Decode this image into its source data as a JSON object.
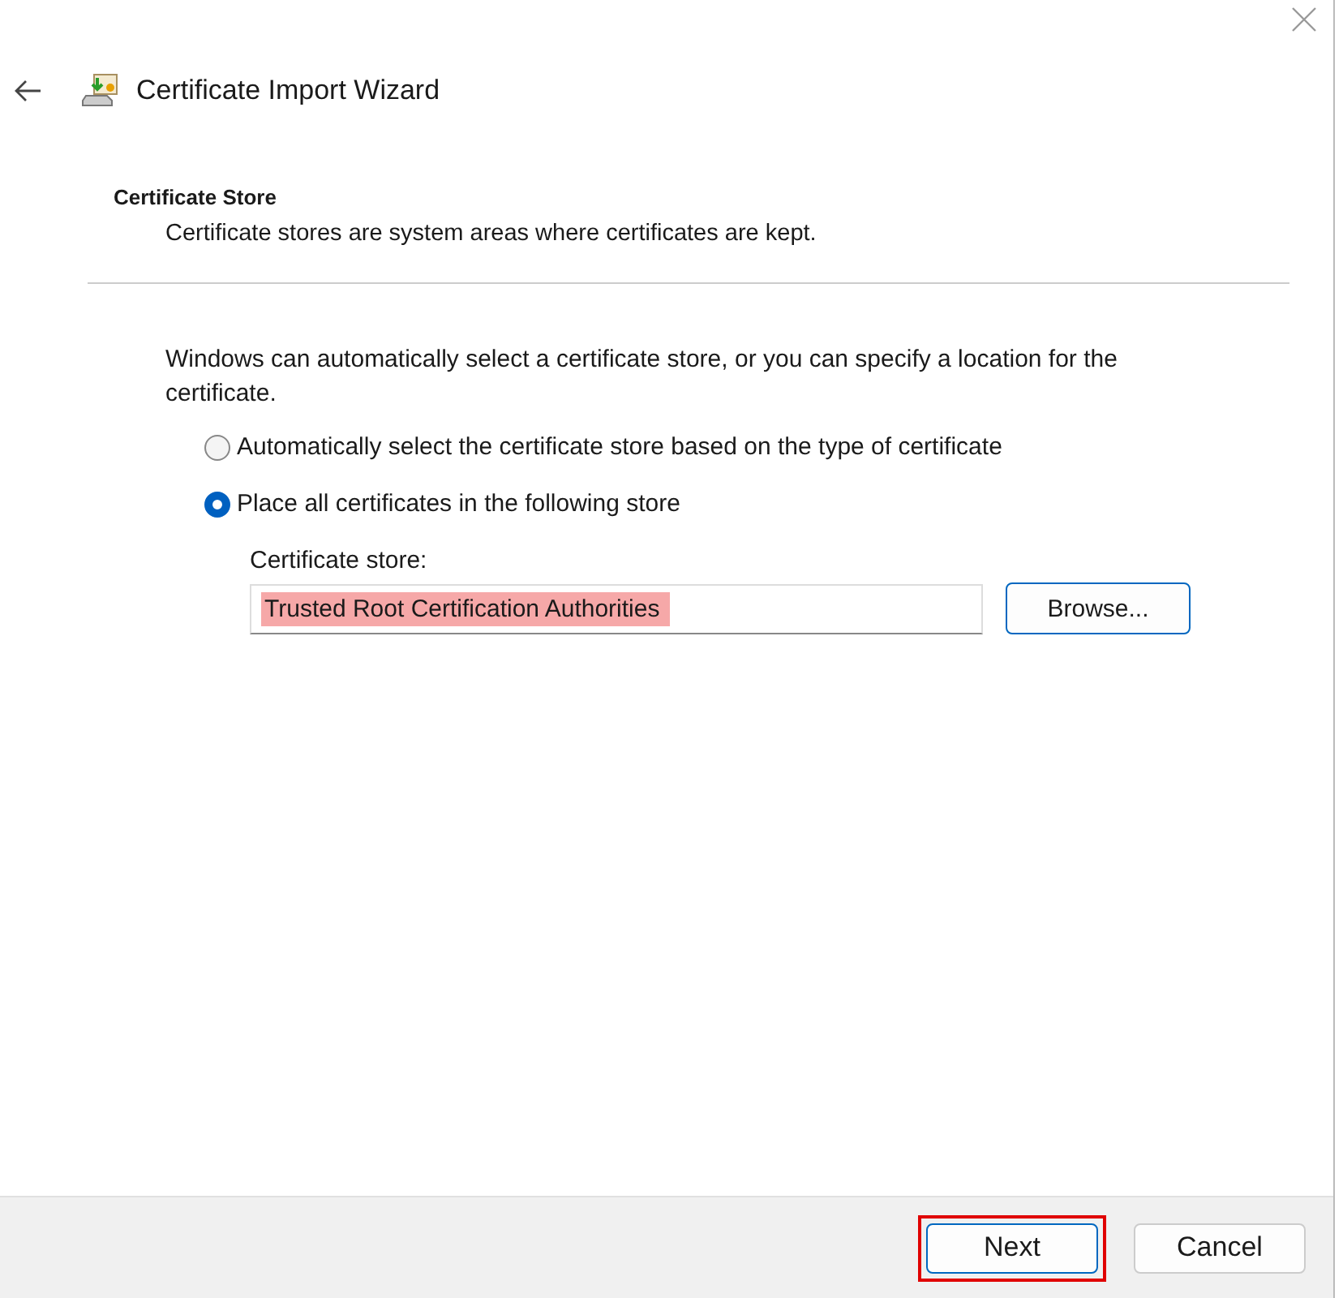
{
  "window": {
    "title": "Certificate Import Wizard"
  },
  "header": {
    "title": "Certificate Store",
    "description": "Certificate stores are system areas where certificates are kept."
  },
  "intro": "Windows can automatically select a certificate store, or you can specify a location for the certificate.",
  "options": [
    {
      "label": "Automatically select the certificate store based on the type of certificate",
      "selected": false
    },
    {
      "label": "Place all certificates in the following store",
      "selected": true
    }
  ],
  "store_field": {
    "label": "Certificate store:",
    "value": "Trusted Root Certification Authorities",
    "highlighted": true
  },
  "browse_button": "Browse...",
  "buttons": [
    {
      "label": "Next",
      "default": true,
      "outlined_red": true
    },
    {
      "label": "Cancel",
      "default": false,
      "outlined_red": false
    }
  ]
}
